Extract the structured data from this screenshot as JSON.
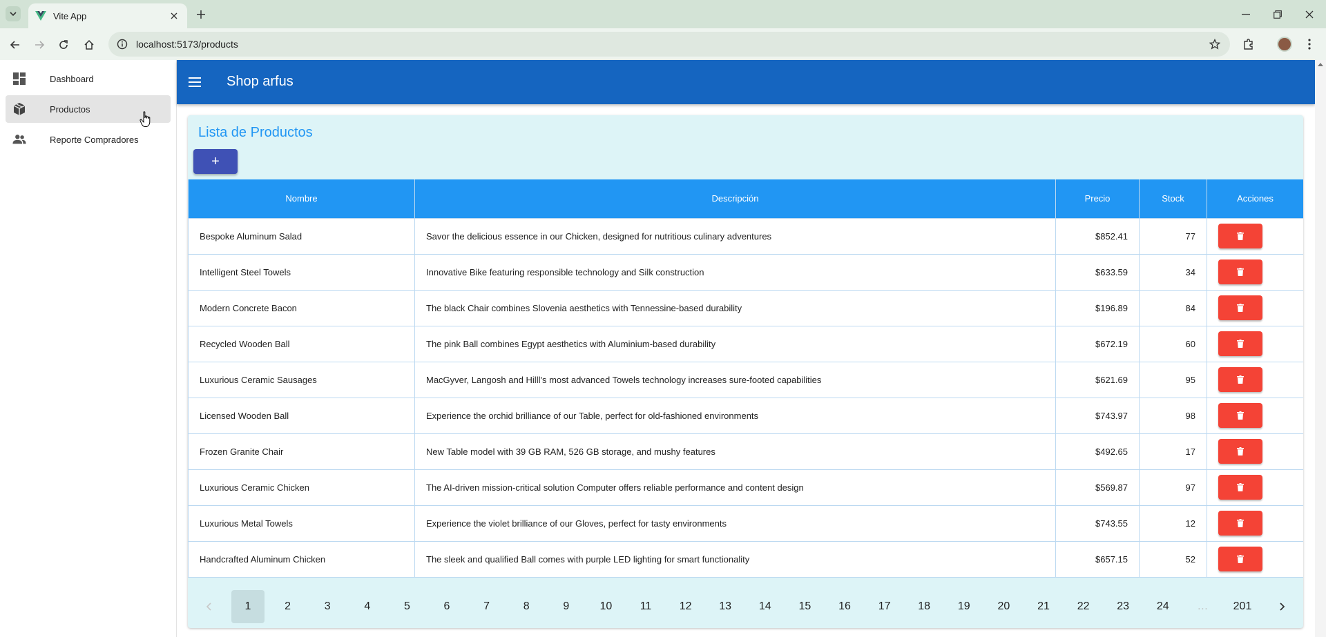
{
  "browser": {
    "tab_title": "Vite App",
    "url": "localhost:5173/products"
  },
  "colors": {
    "appbar": "#1565c0",
    "header": "#2196f3",
    "add_button": "#3f51b5",
    "delete_button": "#f44336",
    "card": "#ddf4f7"
  },
  "sidebar": {
    "items": [
      {
        "label": "Dashboard",
        "icon": "dashboard-icon"
      },
      {
        "label": "Productos",
        "icon": "box-icon"
      },
      {
        "label": "Reporte Compradores",
        "icon": "people-icon"
      }
    ]
  },
  "appbar": {
    "title": "Shop arfus"
  },
  "card": {
    "title": "Lista de Productos",
    "add_label": "+"
  },
  "table": {
    "headers": [
      "Nombre",
      "Descripción",
      "Precio",
      "Stock",
      "Acciones"
    ],
    "rows": [
      {
        "name": "Bespoke Aluminum Salad",
        "desc": "Savor the delicious essence in our Chicken, designed for nutritious culinary adventures",
        "price": "$852.41",
        "stock": "77"
      },
      {
        "name": "Intelligent Steel Towels",
        "desc": "Innovative Bike featuring responsible technology and Silk construction",
        "price": "$633.59",
        "stock": "34"
      },
      {
        "name": "Modern Concrete Bacon",
        "desc": "The black Chair combines Slovenia aesthetics with Tennessine-based durability",
        "price": "$196.89",
        "stock": "84"
      },
      {
        "name": "Recycled Wooden Ball",
        "desc": "The pink Ball combines Egypt aesthetics with Aluminium-based durability",
        "price": "$672.19",
        "stock": "60"
      },
      {
        "name": "Luxurious Ceramic Sausages",
        "desc": "MacGyver, Langosh and Hilll's most advanced Towels technology increases sure-footed capabilities",
        "price": "$621.69",
        "stock": "95"
      },
      {
        "name": "Licensed Wooden Ball",
        "desc": "Experience the orchid brilliance of our Table, perfect for old-fashioned environments",
        "price": "$743.97",
        "stock": "98"
      },
      {
        "name": "Frozen Granite Chair",
        "desc": "New Table model with 39 GB RAM, 526 GB storage, and mushy features",
        "price": "$492.65",
        "stock": "17"
      },
      {
        "name": "Luxurious Ceramic Chicken",
        "desc": "The AI-driven mission-critical solution Computer offers reliable performance and content design",
        "price": "$569.87",
        "stock": "97"
      },
      {
        "name": "Luxurious Metal Towels",
        "desc": "Experience the violet brilliance of our Gloves, perfect for tasty environments",
        "price": "$743.55",
        "stock": "12"
      },
      {
        "name": "Handcrafted Aluminum Chicken",
        "desc": "The sleek and qualified Ball comes with purple LED lighting for smart functionality",
        "price": "$657.15",
        "stock": "52"
      }
    ]
  },
  "pagination": {
    "pages": [
      "1",
      "2",
      "3",
      "4",
      "5",
      "6",
      "7",
      "8",
      "9",
      "10",
      "11",
      "12",
      "13",
      "14",
      "15",
      "16",
      "17",
      "18",
      "19",
      "20",
      "21",
      "22",
      "23",
      "24"
    ],
    "ellipsis": "…",
    "last": "201",
    "current": "1"
  }
}
